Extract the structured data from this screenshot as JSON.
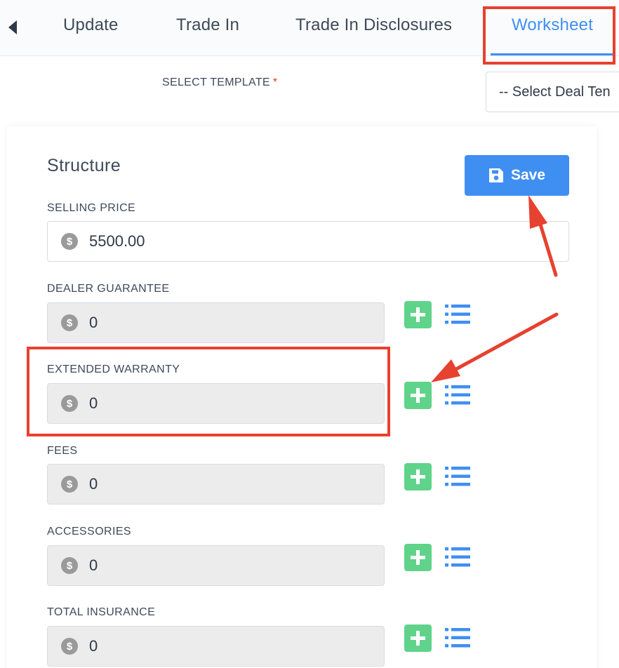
{
  "tabs": [
    {
      "label": "Update"
    },
    {
      "label": "Trade In"
    },
    {
      "label": "Trade In Disclosures"
    },
    {
      "label": "Worksheet",
      "active": true
    }
  ],
  "template": {
    "label": "SELECT TEMPLATE",
    "required_marker": "*",
    "select_value": "-- Select Deal Ten"
  },
  "structure": {
    "title": "Structure",
    "save_label": "Save",
    "currency_symbol": "$",
    "fields": [
      {
        "label": "SELLING PRICE",
        "value": "5500.00"
      },
      {
        "label": "DEALER GUARANTEE",
        "value": "0"
      },
      {
        "label": "EXTENDED WARRANTY",
        "value": "0"
      },
      {
        "label": "FEES",
        "value": "0"
      },
      {
        "label": "ACCESSORIES",
        "value": "0"
      },
      {
        "label": "TOTAL INSURANCE",
        "value": "0"
      }
    ]
  },
  "colors": {
    "accent": "#3f8ff2",
    "add_button": "#5fd38a",
    "annotation": "#e7412f",
    "readonly_field": "#ececec"
  },
  "icons": {
    "back": "chevron-left-icon",
    "save": "floppy-disk-icon",
    "currency": "dollar-circle-icon",
    "add": "plus-icon",
    "list": "list-icon"
  }
}
